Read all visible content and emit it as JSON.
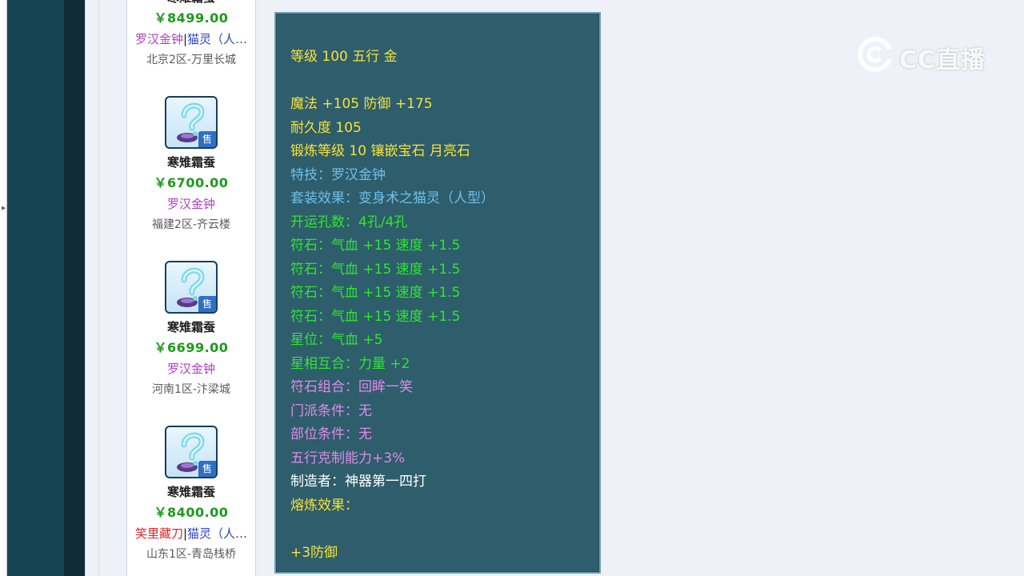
{
  "items": [
    {
      "name": "寒雉霜蚕",
      "price": "￥8499.00",
      "tag1": "罗汉金钟",
      "tag1_color": "purple",
      "sep": "|",
      "tag2": "猫灵（人…",
      "server": "北京2区-万里长城"
    },
    {
      "name": "寒雉霜蚕",
      "price": "￥6700.00",
      "tag1": "罗汉金钟",
      "tag1_color": "purple",
      "sep": "",
      "tag2": "",
      "server": "福建2区-齐云楼"
    },
    {
      "name": "寒雉霜蚕",
      "price": "￥6699.00",
      "tag1": "罗汉金钟",
      "tag1_color": "purple",
      "sep": "",
      "tag2": "",
      "server": "河南1区-汴梁城"
    },
    {
      "name": "寒雉霜蚕",
      "price": "￥8400.00",
      "tag1": "笑里藏刀",
      "tag1_color": "red",
      "sep": "|",
      "tag2": "猫灵（人…",
      "server": "山东1区-青岛栈桥"
    }
  ],
  "sell_tag": "售",
  "tooltip": {
    "lines": [
      {
        "text": "等级 100 五行 金",
        "color": "yellow"
      },
      {
        "text": "",
        "color": "yellow"
      },
      {
        "text": "魔法 +105 防御 +175",
        "color": "yellow"
      },
      {
        "text": "耐久度 105",
        "color": "yellow"
      },
      {
        "text": "锻炼等级 10 镶嵌宝石 月亮石",
        "color": "yellow"
      },
      {
        "text": "特技：罗汉金钟",
        "color": "blue"
      },
      {
        "text": "套装效果：变身术之猫灵（人型）",
        "color": "blue"
      },
      {
        "text": "开运孔数：4孔/4孔",
        "color": "green"
      },
      {
        "text": "符石：气血 +15 速度 +1.5",
        "color": "green"
      },
      {
        "text": "符石：气血 +15 速度 +1.5",
        "color": "green"
      },
      {
        "text": "符石：气血 +15 速度 +1.5",
        "color": "green"
      },
      {
        "text": "符石：气血 +15 速度 +1.5",
        "color": "green"
      },
      {
        "text": "星位：气血 +5",
        "color": "green"
      },
      {
        "text": "星相互合：力量 +2",
        "color": "green"
      },
      {
        "text": "符石组合：回眸一笑",
        "color": "pink"
      },
      {
        "text": "门派条件：无",
        "color": "pink"
      },
      {
        "text": "部位条件：无",
        "color": "pink"
      },
      {
        "text": "五行克制能力+3%",
        "color": "pink"
      },
      {
        "text": "制造者：神器第一四打",
        "color": "white"
      },
      {
        "text": "熔炼效果：",
        "color": "yellow"
      },
      {
        "text": "",
        "color": "yellow"
      },
      {
        "text": "+3防御",
        "color": "yellow"
      }
    ]
  },
  "watermark": {
    "text": "CC直播"
  }
}
